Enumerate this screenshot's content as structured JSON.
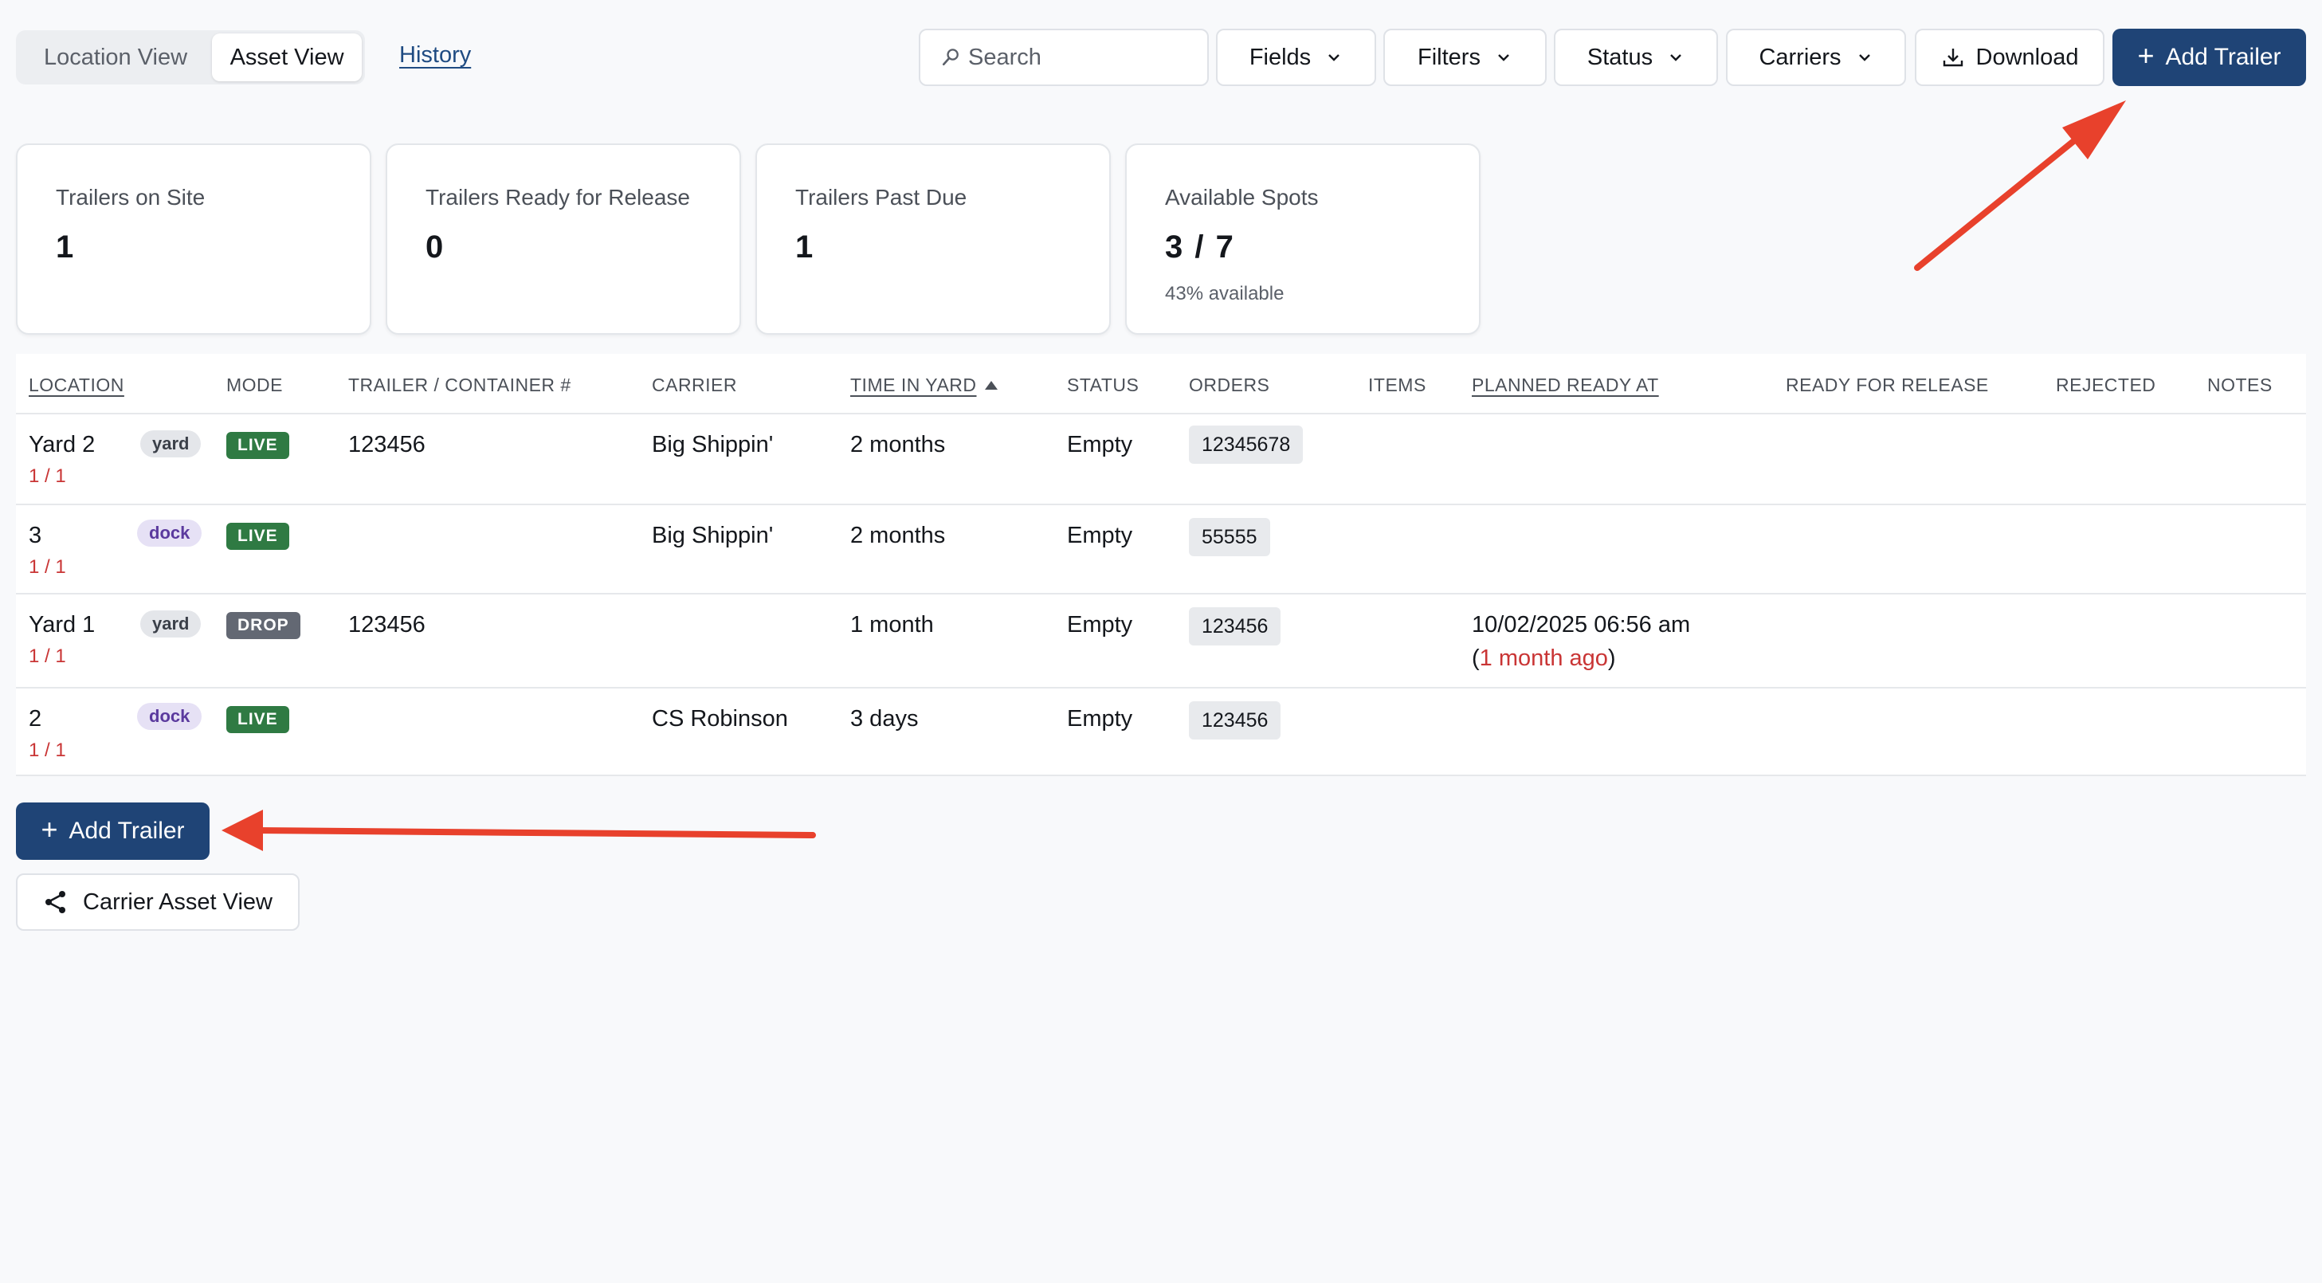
{
  "view_toggle": {
    "location_view": "Location View",
    "asset_view": "Asset View"
  },
  "history_link": "History",
  "search": {
    "placeholder": "Search",
    "value": ""
  },
  "toolbar": {
    "fields": "Fields",
    "filters": "Filters",
    "status": "Status",
    "carriers": "Carriers",
    "download": "Download",
    "add_trailer": "Add Trailer"
  },
  "stats": [
    {
      "label": "Trailers on Site",
      "value": "1"
    },
    {
      "label": "Trailers Ready for Release",
      "value": "0"
    },
    {
      "label": "Trailers Past Due",
      "value": "1"
    },
    {
      "label": "Available Spots",
      "value": "3 / 7",
      "sub": "43% available"
    }
  ],
  "table": {
    "headers": {
      "location": "Location",
      "mode": "Mode",
      "trailer": "Trailer / Container #",
      "carrier": "Carrier",
      "time_in_yard": "Time in Yard",
      "status": "Status",
      "orders": "Orders",
      "items": "Items",
      "planned_ready_at": "Planned Ready At",
      "ready_for_release": "Ready for Release",
      "rejected": "Rejected",
      "notes": "Notes"
    },
    "rows": [
      {
        "location": "Yard 2",
        "location_sub": "1 / 1",
        "spot_type": "yard",
        "mode": "LIVE",
        "trailer": "123456",
        "carrier": "Big Shippin'",
        "time_in_yard": "2 months",
        "status": "Empty",
        "order": "12345678",
        "planned_date": "",
        "planned_ago": ""
      },
      {
        "location": "3",
        "location_sub": "1 / 1",
        "spot_type": "dock",
        "mode": "LIVE",
        "trailer": "",
        "carrier": "Big Shippin'",
        "time_in_yard": "2 months",
        "status": "Empty",
        "order": "55555",
        "planned_date": "",
        "planned_ago": ""
      },
      {
        "location": "Yard 1",
        "location_sub": "1 / 1",
        "spot_type": "yard",
        "mode": "DROP",
        "trailer": "123456",
        "carrier": "",
        "time_in_yard": "1 month",
        "status": "Empty",
        "order": "123456",
        "planned_date": "10/02/2025 06:56 am",
        "planned_ago": "1 month ago"
      },
      {
        "location": "2",
        "location_sub": "1 / 1",
        "spot_type": "dock",
        "mode": "LIVE",
        "trailer": "",
        "carrier": "CS Robinson",
        "time_in_yard": "3 days",
        "status": "Empty",
        "order": "123456",
        "planned_date": "",
        "planned_ago": ""
      }
    ]
  },
  "bottom": {
    "add_trailer": "Add Trailer",
    "carrier_asset_view": "Carrier Asset View"
  },
  "colors": {
    "primary": "#1f4476",
    "live": "#2f7a43",
    "drop": "#636873",
    "alert": "#c93535",
    "annotation": "#e8412c"
  }
}
